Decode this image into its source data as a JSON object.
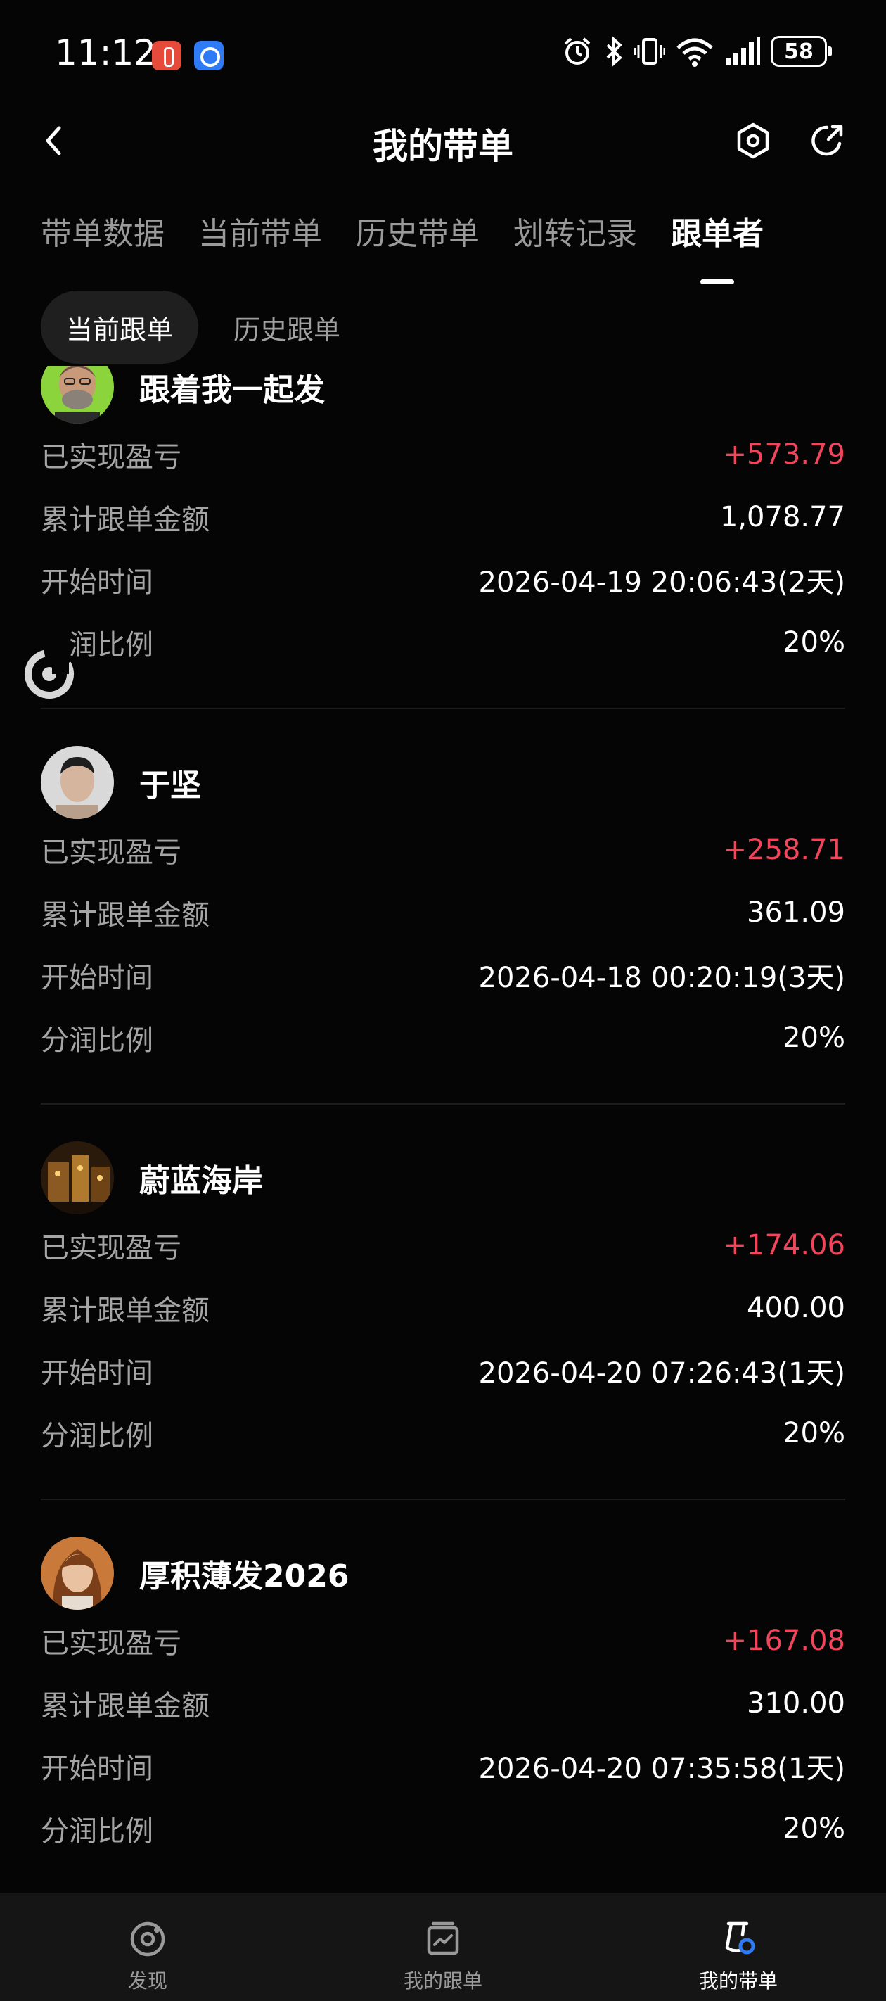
{
  "status_bar": {
    "time": "11:12",
    "battery": "58"
  },
  "header": {
    "title": "我的带单"
  },
  "tabs": [
    {
      "label": "带单数据"
    },
    {
      "label": "当前带单"
    },
    {
      "label": "历史带单"
    },
    {
      "label": "划转记录"
    },
    {
      "label": "跟单者"
    }
  ],
  "segment": {
    "current": "当前跟单",
    "history": "历史跟单"
  },
  "labels": {
    "pnl": "已实现盈亏",
    "amount": "累计跟单金额",
    "start": "开始时间",
    "share": "分润比例",
    "share_partial": "润比例"
  },
  "followers": [
    {
      "name": "跟着我一起发",
      "pnl": "+573.79",
      "amount": "1,078.77",
      "start": "2026-04-19 20:06:43(2天)",
      "share": "20%"
    },
    {
      "name": "于坚",
      "pnl": "+258.71",
      "amount": "361.09",
      "start": "2026-04-18 00:20:19(3天)",
      "share": "20%"
    },
    {
      "name": "蔚蓝海岸",
      "pnl": "+174.06",
      "amount": "400.00",
      "start": "2026-04-20 07:26:43(1天)",
      "share": "20%"
    },
    {
      "name": "厚积薄发2026",
      "pnl": "+167.08",
      "amount": "310.00",
      "start": "2026-04-20 07:35:58(1天)",
      "share": "20%"
    }
  ],
  "bottom_nav": [
    {
      "label": "发现"
    },
    {
      "label": "我的跟单"
    },
    {
      "label": "我的带单"
    }
  ],
  "colors": {
    "positive": "#f0465d",
    "background": "#050505",
    "nav_active_accent": "#2f7bf5"
  }
}
